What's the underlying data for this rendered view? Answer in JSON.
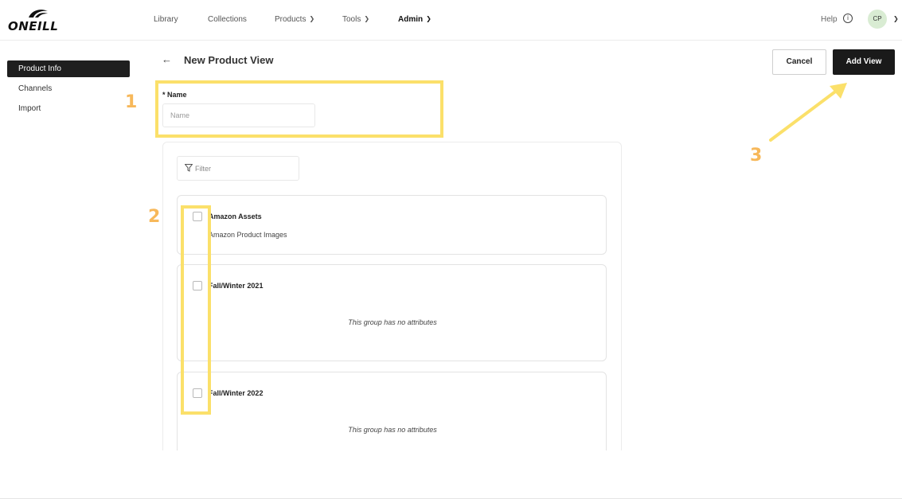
{
  "brand": {
    "logo_text": "ONEILL"
  },
  "nav": {
    "items": [
      {
        "label": "Library",
        "dropdown": false
      },
      {
        "label": "Collections",
        "dropdown": false
      },
      {
        "label": "Products",
        "dropdown": true
      },
      {
        "label": "Tools",
        "dropdown": true
      },
      {
        "label": "Admin",
        "dropdown": true
      }
    ],
    "help_label": "Help",
    "avatar_initials": "CP"
  },
  "sidebar": {
    "items": [
      {
        "label": "Product Info",
        "active": true
      },
      {
        "label": "Channels",
        "active": false
      },
      {
        "label": "Import",
        "active": false
      }
    ]
  },
  "header": {
    "title": "New Product View",
    "cancel_label": "Cancel",
    "add_label": "Add View"
  },
  "form": {
    "name_label": "* Name",
    "name_placeholder": "Name",
    "name_value": "",
    "filter_placeholder": "Filter"
  },
  "groups": [
    {
      "name": "Amazon Assets",
      "subtitle": "Amazon Product Images",
      "empty_text": ""
    },
    {
      "name": "Fall/Winter 2021",
      "subtitle": "",
      "empty_text": "This group has no attributes"
    },
    {
      "name": "Fall/Winter 2022",
      "subtitle": "",
      "empty_text": "This group has no attributes"
    }
  ],
  "annotations": {
    "step1": "1",
    "step2": "2",
    "step3": "3",
    "highlight_color": "#fbe06a",
    "number_color": "#f7b85a"
  }
}
